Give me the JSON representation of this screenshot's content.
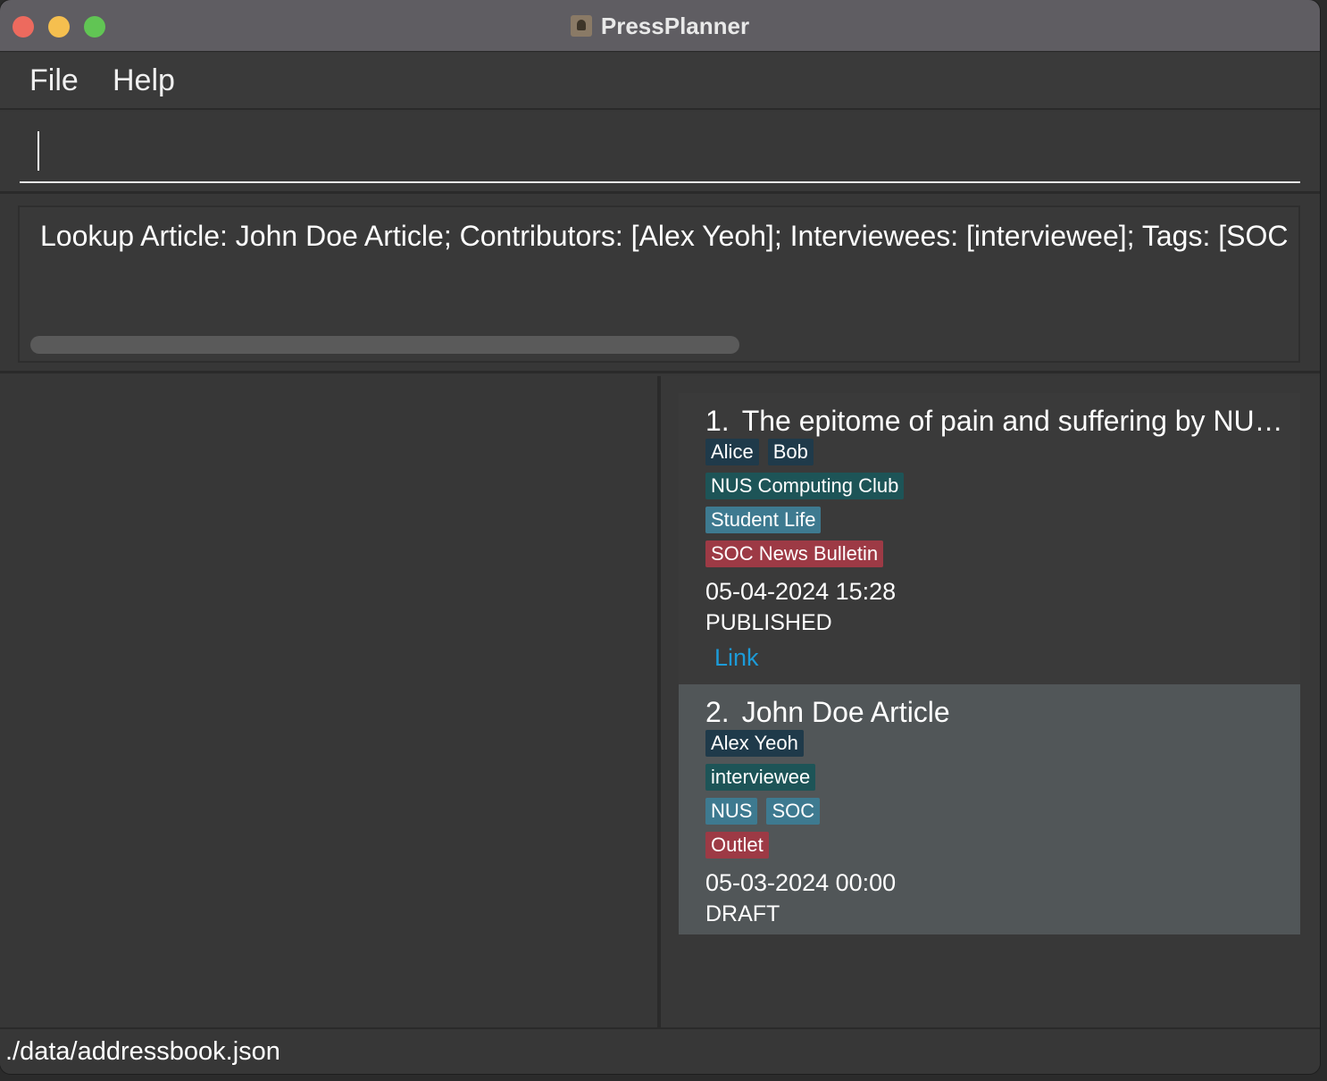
{
  "window": {
    "title": "PressPlanner"
  },
  "menu": {
    "file": "File",
    "help": "Help"
  },
  "command": {
    "value": "",
    "placeholder": ""
  },
  "result": {
    "text": "Lookup Article: John Doe Article; Contributors: [Alex Yeoh]; Interviewees: [interviewee]; Tags: [SOC"
  },
  "articles": [
    {
      "index": "1.",
      "title": "The epitome of pain and suffering by NUS Computing Club",
      "contributors": [
        "Alice",
        "Bob"
      ],
      "interviewees": [
        "NUS Computing Club"
      ],
      "tags": [
        "Student Life"
      ],
      "outlets": [
        "SOC News Bulletin"
      ],
      "date": "05-04-2024 15:28",
      "status": "PUBLISHED",
      "link": "Link"
    },
    {
      "index": "2.",
      "title": "John Doe Article",
      "contributors": [
        "Alex Yeoh"
      ],
      "interviewees": [
        "interviewee"
      ],
      "tags": [
        "NUS",
        "SOC"
      ],
      "outlets": [
        "Outlet"
      ],
      "date": "05-03-2024 00:00",
      "status": "DRAFT"
    }
  ],
  "status_bar": {
    "path": "./data/addressbook.json"
  },
  "colors": {
    "contributor_tag": "#1f3a4a",
    "interviewee_tag": "#1d5457",
    "topic_tag": "#3e7a90",
    "outlet_tag": "#9d3a45",
    "link": "#1c9bd8",
    "selected_card": "#515658"
  }
}
